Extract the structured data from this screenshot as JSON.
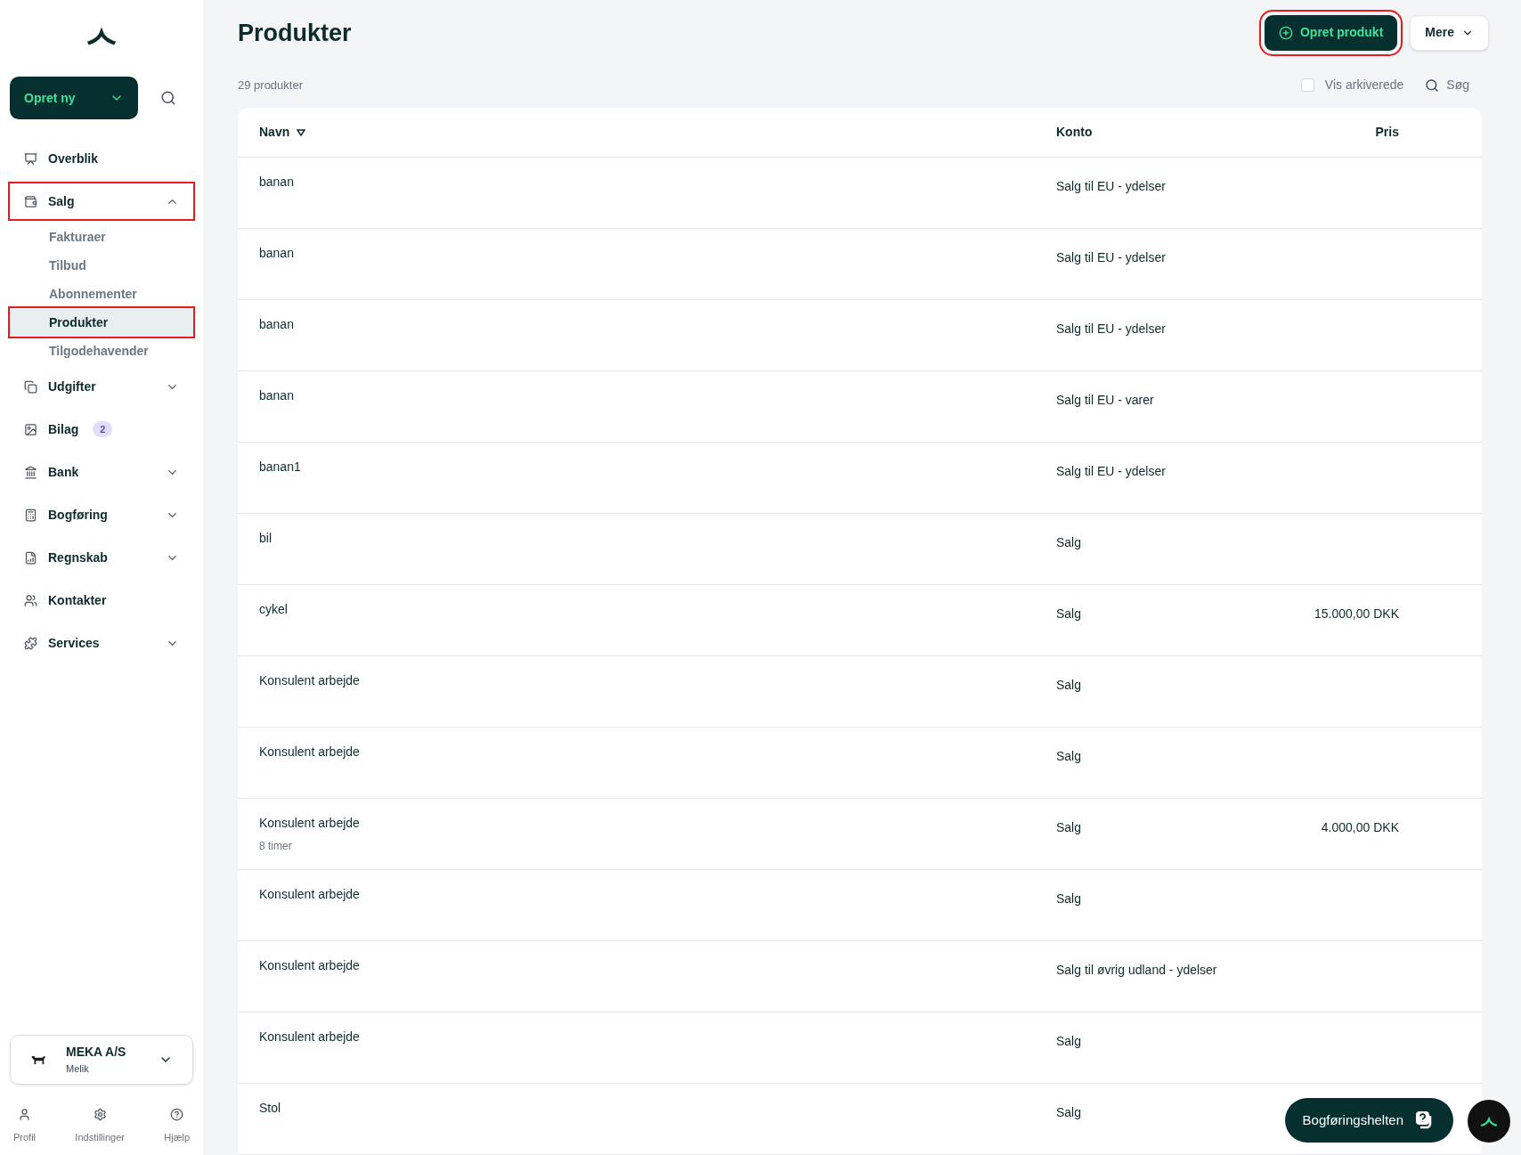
{
  "sidebar": {
    "create_button": "Opret ny",
    "nav": [
      {
        "label": "Overblik",
        "highlighted": false
      },
      {
        "label": "Salg",
        "expanded": true,
        "highlighted": true,
        "children": [
          {
            "label": "Fakturaer",
            "selected": false,
            "highlighted": false
          },
          {
            "label": "Tilbud",
            "selected": false,
            "highlighted": false
          },
          {
            "label": "Abonnementer",
            "selected": false,
            "highlighted": false
          },
          {
            "label": "Produkter",
            "selected": true,
            "highlighted": true
          },
          {
            "label": "Tilgodehavender",
            "selected": false,
            "highlighted": false
          }
        ]
      },
      {
        "label": "Udgifter",
        "expanded": false,
        "highlighted": false
      },
      {
        "label": "Bilag",
        "badge": "2",
        "highlighted": false
      },
      {
        "label": "Bank",
        "expanded": false,
        "highlighted": false
      },
      {
        "label": "Bogføring",
        "expanded": false,
        "highlighted": false
      },
      {
        "label": "Regnskab",
        "expanded": false,
        "highlighted": false
      },
      {
        "label": "Kontakter",
        "highlighted": false
      },
      {
        "label": "Services",
        "expanded": false,
        "highlighted": false
      }
    ],
    "company": {
      "name": "MEKA A/S",
      "user": "Melik"
    },
    "footer": [
      "Profil",
      "Indstillinger",
      "Hjælp"
    ]
  },
  "page": {
    "title": "Produkter",
    "create_button": {
      "label": "Opret produkt",
      "highlighted": true
    },
    "more_button": "Mere",
    "count": "29 produkter",
    "archive_toggle": {
      "label": "Vis arkiverede",
      "checked": false
    },
    "search": "Søg"
  },
  "table": {
    "columns": [
      {
        "label": "Navn",
        "sorted": true
      },
      {
        "label": "Konto",
        "sorted": false
      },
      {
        "label": "Pris",
        "sorted": false
      }
    ],
    "rows": [
      {
        "name": "banan",
        "account": "Salg til EU - ydelser"
      },
      {
        "name": "banan",
        "account": "Salg til EU - ydelser"
      },
      {
        "name": "banan",
        "account": "Salg til EU - ydelser"
      },
      {
        "name": "banan",
        "account": "Salg til EU - varer"
      },
      {
        "name": "banan1",
        "account": "Salg til EU - ydelser"
      },
      {
        "name": "bil",
        "account": "Salg"
      },
      {
        "name": "cykel",
        "account": "Salg",
        "price": "15.000,00 DKK"
      },
      {
        "name": "Konsulent arbejde",
        "account": "Salg"
      },
      {
        "name": "Konsulent arbejde",
        "account": "Salg"
      },
      {
        "name": "Konsulent arbejde",
        "note": "8 timer",
        "account": "Salg",
        "price": "4.000,00 DKK"
      },
      {
        "name": "Konsulent arbejde",
        "account": "Salg"
      },
      {
        "name": "Konsulent arbejde",
        "account": "Salg til øvrig udland - ydelser"
      },
      {
        "name": "Konsulent arbejde",
        "account": "Salg"
      },
      {
        "name": "Stol",
        "account": "Salg"
      }
    ]
  },
  "help_button": "Bogføringshelten"
}
